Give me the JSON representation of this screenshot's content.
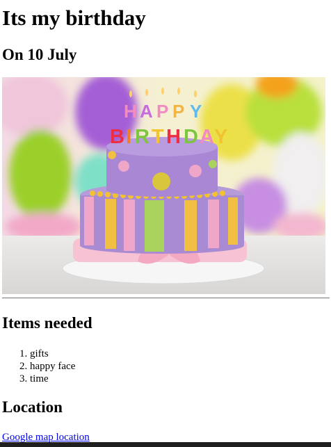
{
  "page": {
    "title": "Its my birthday",
    "date_heading": "On 10 July",
    "cake_image": {
      "topper_line1": "HAPPY",
      "topper_line2": "BIRTHDAY"
    },
    "items_heading": "Items needed",
    "items": [
      "gifts",
      "happy face",
      "time"
    ],
    "location_heading": "Location",
    "map_link_text": "Google map location"
  }
}
